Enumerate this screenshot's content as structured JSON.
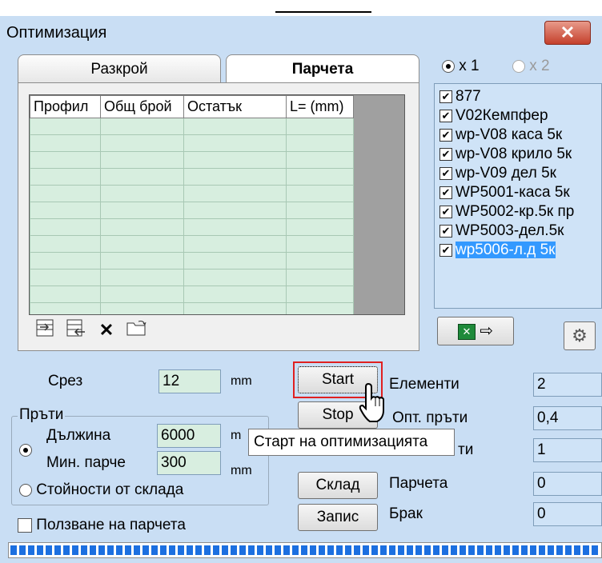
{
  "window": {
    "title": "Оптимизация",
    "close_glyph": "✕"
  },
  "tabs": [
    {
      "label": "Разкрой",
      "active": false
    },
    {
      "label": "Парчета",
      "active": true
    }
  ],
  "grid": {
    "columns": [
      "Профил",
      "Общ брой",
      "Остатък",
      "L= (mm)"
    ],
    "empty_rows": 12
  },
  "toolbar_icons": [
    "import-icon",
    "export-icon",
    "delete-icon",
    "open-folder-icon"
  ],
  "radios_top": {
    "x1": "x 1",
    "x2": "x 2"
  },
  "profiles": [
    {
      "label": "877",
      "checked": true,
      "selected": false
    },
    {
      "label": "V02Кемпфер",
      "checked": true,
      "selected": false
    },
    {
      "label": "wp-V08 каса 5к",
      "checked": true,
      "selected": false
    },
    {
      "label": "wp-V08 крило 5к",
      "checked": true,
      "selected": false
    },
    {
      "label": "wp-V09 дел 5к",
      "checked": true,
      "selected": false
    },
    {
      "label": "WP5001-каса 5к",
      "checked": true,
      "selected": false
    },
    {
      "label": "WP5002-кр.5к пр",
      "checked": true,
      "selected": false
    },
    {
      "label": "WP5003-дел.5к",
      "checked": true,
      "selected": false
    },
    {
      "label": "wp5006-л.д 5к",
      "checked": true,
      "selected": true
    }
  ],
  "cut": {
    "label": "Срез",
    "value": "12",
    "unit": "mm"
  },
  "bars": {
    "group_label": "Пръти",
    "length_label": "Дължина",
    "length_value": "6000",
    "length_unit": "m",
    "min_label": "Мин. парче",
    "min_value": "300",
    "min_unit": "mm",
    "stock_label": "Стойности от склада",
    "use_pieces_label": "Ползване на парчета"
  },
  "buttons": {
    "start": "Start",
    "stop": "Stop",
    "stock": "Склад",
    "save": "Запис"
  },
  "stats": [
    {
      "label": "Елементи",
      "value": "2"
    },
    {
      "label": "Опт. пръти",
      "value": "0,4"
    },
    {
      "label": "ти",
      "value": "1"
    },
    {
      "label": "Парчета",
      "value": "0"
    },
    {
      "label": "Брак",
      "value": "0"
    }
  ],
  "tooltip": "Старт на оптимизацията",
  "colors": {
    "window_bg": "#c9def4",
    "grid_cell": "#d7eedf",
    "accent_blue": "#1c6fe0",
    "start_outline": "#e02020"
  }
}
